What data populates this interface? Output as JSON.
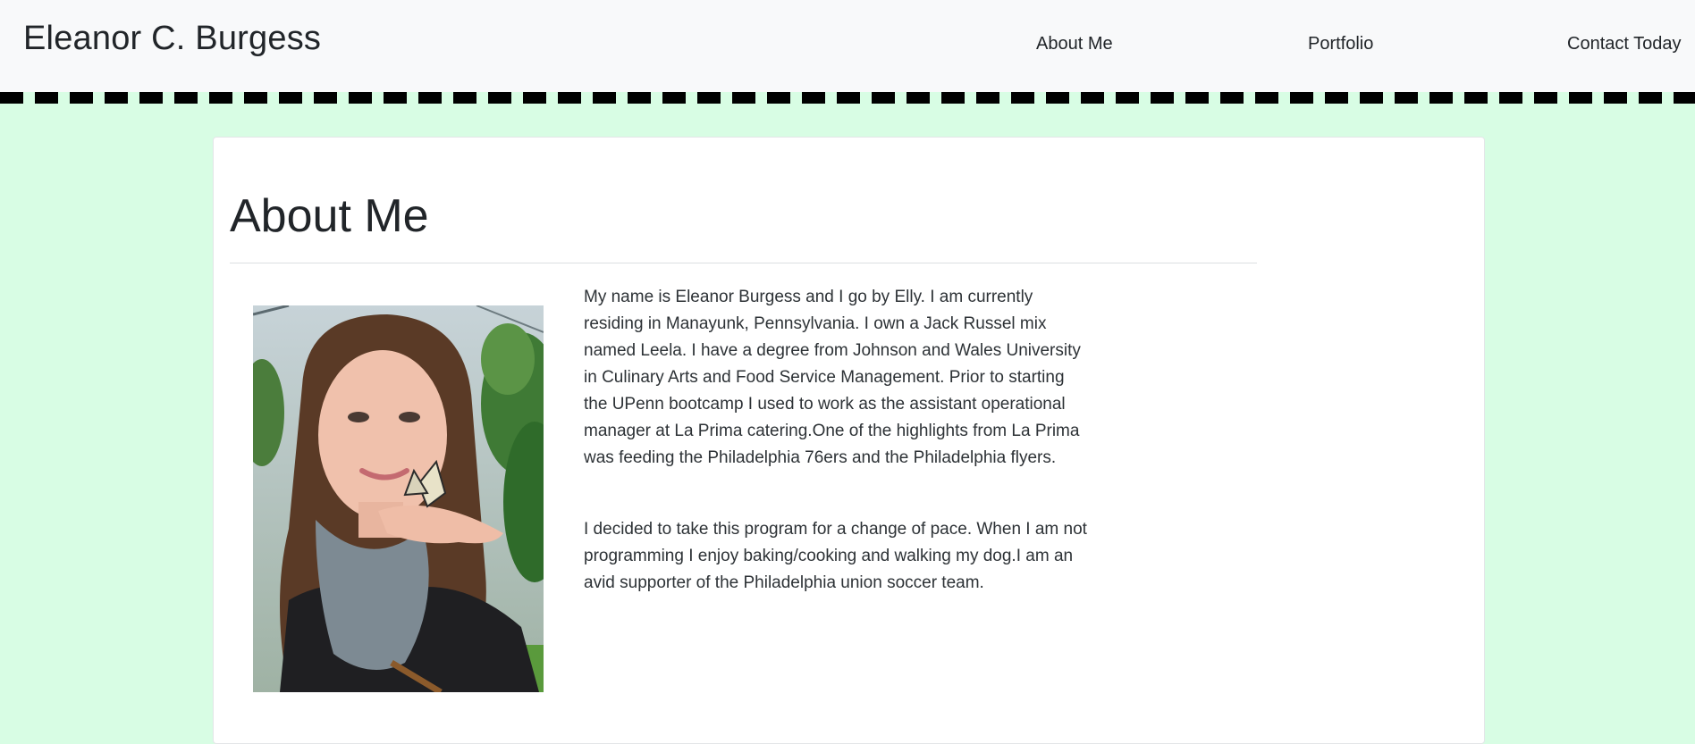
{
  "navbar": {
    "brand": "Eleanor C. Burgess",
    "links": [
      {
        "label": "About Me"
      },
      {
        "label": "Portfolio"
      },
      {
        "label": "Contact Today"
      }
    ]
  },
  "about": {
    "title": "About Me",
    "photo_description": "profile-photo",
    "paragraphs": [
      "My name is Eleanor Burgess and I go by Elly. I am currently residing in Manayunk, Pennsylvania. I own a Jack Russel mix named Leela. I have a degree from Johnson and Wales University in Culinary Arts and Food Service Management. Prior to starting the UPenn bootcamp I used to work as the assistant operational manager at La Prima catering.One of the highlights from La Prima was feeding the Philadelphia 76ers and the Philadelphia flyers.",
      "I decided to take this program for a change of pace. When I am not programming I enjoy baking/cooking and walking my dog.I am an avid supporter of the Philadelphia union soccer team."
    ]
  },
  "colors": {
    "page_background": "#d8fde4",
    "navbar_background": "#f8f9fa",
    "dash_border": "#000000",
    "card_background": "#ffffff"
  }
}
